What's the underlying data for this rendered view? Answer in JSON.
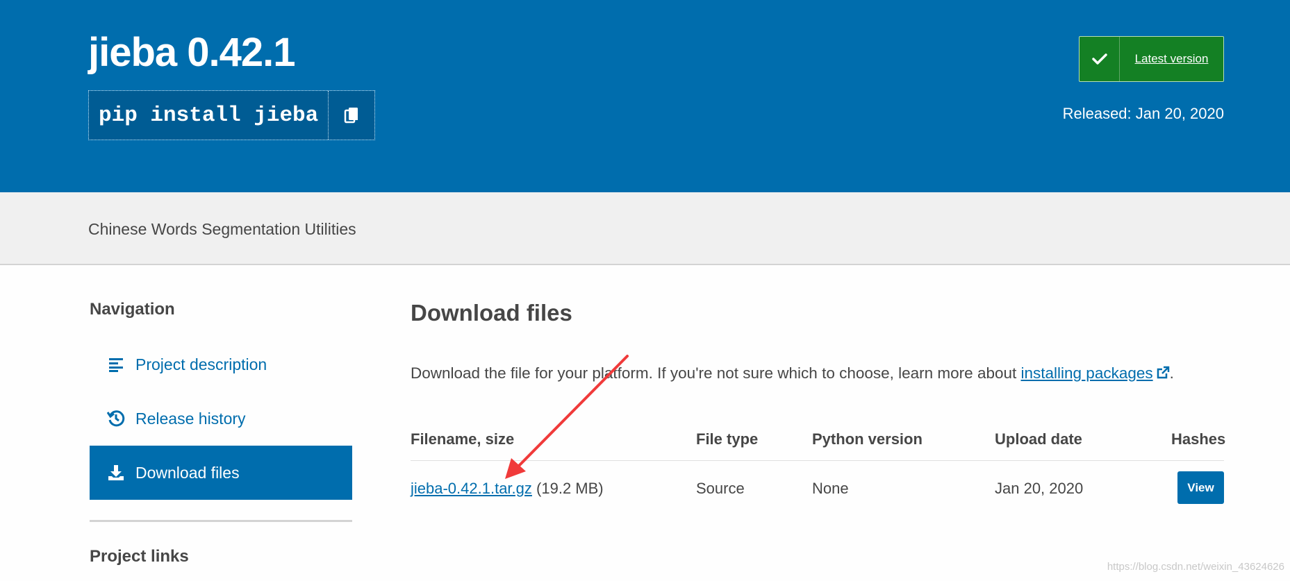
{
  "header": {
    "title": "jieba 0.42.1",
    "pip_command": "pip install jieba",
    "latest_label": "Latest version",
    "released": "Released: Jan 20, 2020"
  },
  "summary": "Chinese Words Segmentation Utilities",
  "sidebar": {
    "heading": "Navigation",
    "items": [
      {
        "label": "Project description",
        "icon": "align-left-icon"
      },
      {
        "label": "Release history",
        "icon": "history-icon"
      },
      {
        "label": "Download files",
        "icon": "download-icon",
        "active": true
      }
    ],
    "links_heading": "Project links"
  },
  "main": {
    "heading": "Download files",
    "intro_before": "Download the file for your platform. If you're not sure which to choose, learn more about ",
    "intro_link": "installing packages",
    "intro_after": ".",
    "table": {
      "headers": [
        "Filename, size",
        "File type",
        "Python version",
        "Upload date",
        "Hashes"
      ],
      "rows": [
        {
          "filename": "jieba-0.42.1.tar.gz",
          "size": "(19.2 MB)",
          "file_type": "Source",
          "python_version": "None",
          "upload_date": "Jan 20, 2020",
          "hash_button": "View"
        }
      ]
    }
  },
  "watermark": "https://blog.csdn.net/weixin_43624626",
  "colors": {
    "banner": "#006dad",
    "latest_button": "#148024",
    "summary_bar": "#f0f0f0",
    "link": "#006dad",
    "annotation_arrow": "#f03a3a"
  }
}
